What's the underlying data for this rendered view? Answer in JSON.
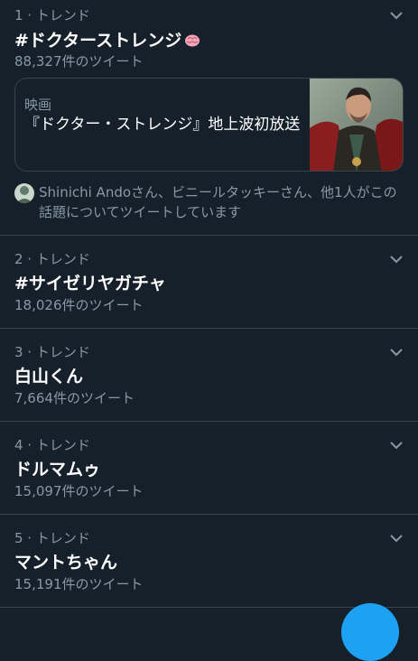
{
  "trends": [
    {
      "meta": "1 · トレンド",
      "title": "#ドクターストレンジ",
      "count": "88,327件のツイート",
      "card": {
        "category": "映画",
        "headline": "『ドクター・ストレンジ』地上波初放送"
      },
      "context": "Shinichi Andoさん、ビニールタッキーさん、他1人がこの話題についてツイートしています"
    },
    {
      "meta": "2 · トレンド",
      "title": "#サイゼリヤガチャ",
      "count": "18,026件のツイート"
    },
    {
      "meta": "3 · トレンド",
      "title": "白山くん",
      "count": "7,664件のツイート"
    },
    {
      "meta": "4 · トレンド",
      "title": "ドルマムゥ",
      "count": "15,097件のツイート"
    },
    {
      "meta": "5 · トレンド",
      "title": "マントちゃん",
      "count": "15,191件のツイート"
    }
  ],
  "icons": {
    "chevron": "chevron-down-icon",
    "emoji": "brain-emoji-icon",
    "compose": "compose-tweet-button"
  },
  "colors": {
    "background": "#15202b",
    "border": "#38444d",
    "secondary_text": "#8899a6",
    "primary_text": "#ffffff",
    "accent": "#1da1f2"
  }
}
